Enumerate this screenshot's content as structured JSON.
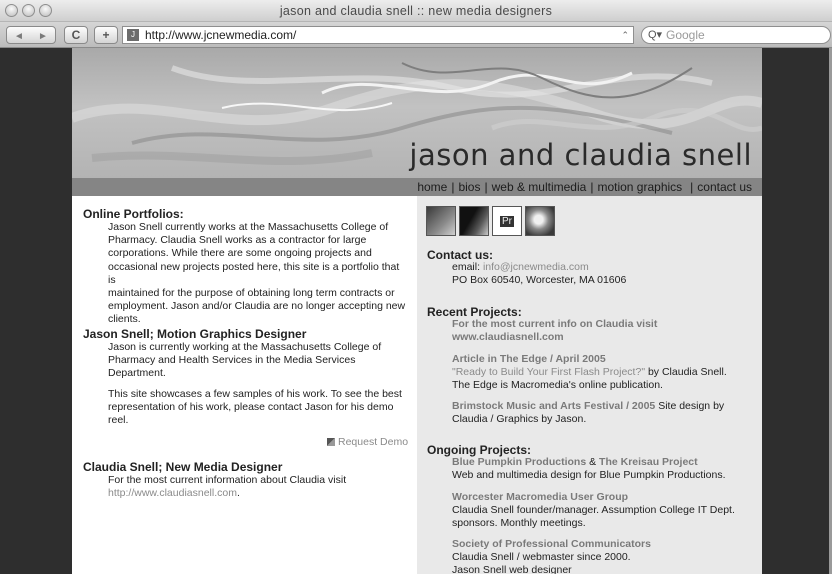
{
  "window": {
    "title": "jason and claudia snell :: new media designers"
  },
  "browser": {
    "back_label": "◄",
    "forward_label": "►",
    "reload_label": "C",
    "add_label": "+",
    "url": "http://www.jcnewmedia.com/",
    "search_placeholder": "Google"
  },
  "site": {
    "title": "jason and claudia snell",
    "nav": [
      {
        "label": "home"
      },
      {
        "label": "bios"
      },
      {
        "label": "web & multimedia"
      },
      {
        "label": "motion graphics"
      },
      {
        "label": "contact us"
      }
    ]
  },
  "left": {
    "portfolios_heading": "Online Portfolios:",
    "portfolios_lines": [
      "Jason Snell currently works at the Massachusetts College of",
      "Pharmacy. Claudia Snell works as a contractor for large",
      "corporations. While there are some ongoing projects and",
      "occasional new projects posted here, this site is a portfolio that is",
      "maintained for the purpose of obtaining long term contracts or",
      "employment. Jason and/or Claudia are no longer accepting new",
      "clients."
    ],
    "jason_heading": "Jason Snell; Motion Graphics Designer",
    "jason_lines": [
      "Jason is currently working at the Massachusetts College of",
      "Pharmacy and Health Services in the Media Services",
      "Department."
    ],
    "jason_lines2": [
      "This site showcases a few samples of his work. To see the best",
      "representation of his work, please contact Jason for his demo",
      "reel."
    ],
    "request_demo": "Request Demo",
    "claudia_heading": "Claudia Snell; New Media Designer",
    "claudia_line1": "For the most current information about Claudia visit",
    "claudia_link": "http://www.claudiasnell.com",
    "claudia_link_end": "."
  },
  "right": {
    "thumbs": [
      "ae",
      "fl",
      "pr",
      "dw"
    ],
    "contact_heading": "Contact us:",
    "email_label": "email: ",
    "email": "info@jcnewmedia.com",
    "address": "PO Box 60540, Worcester, MA 01606",
    "recent_heading": "Recent Projects:",
    "recent1_a": "For the most current info on Claudia visit",
    "recent1_b": "www.claudiasnell.com",
    "recent2_title": "Article in The Edge / April 2005",
    "recent2_link": "\"Ready to Build Your First Flash Project?\"",
    "recent2_by": " by Claudia Snell.",
    "recent2_desc": "The Edge is Macromedia's online publication.",
    "recent3_title": "Brimstock Music and Arts Festival / 2005",
    "recent3_desc1": " Site design by",
    "recent3_desc2": "Claudia / Graphics by Jason.",
    "ongoing_heading": "Ongoing Projects:",
    "ongoing1_a": "Blue Pumpkin Productions",
    "ongoing1_amp": " & ",
    "ongoing1_b": "The Kreisau Project",
    "ongoing1_desc": "Web and multimedia design for Blue Pumpkin Productions.",
    "ongoing2_title": "Worcester Macromedia User Group",
    "ongoing2_desc1": "Claudia Snell founder/manager. Assumption College IT Dept.",
    "ongoing2_desc2": "sponsors. Monthly meetings.",
    "ongoing3_title": "Society of Professional Communicators",
    "ongoing3_desc1": "Claudia Snell / webmaster since 2000.",
    "ongoing3_desc2": "Jason Snell web designer"
  }
}
